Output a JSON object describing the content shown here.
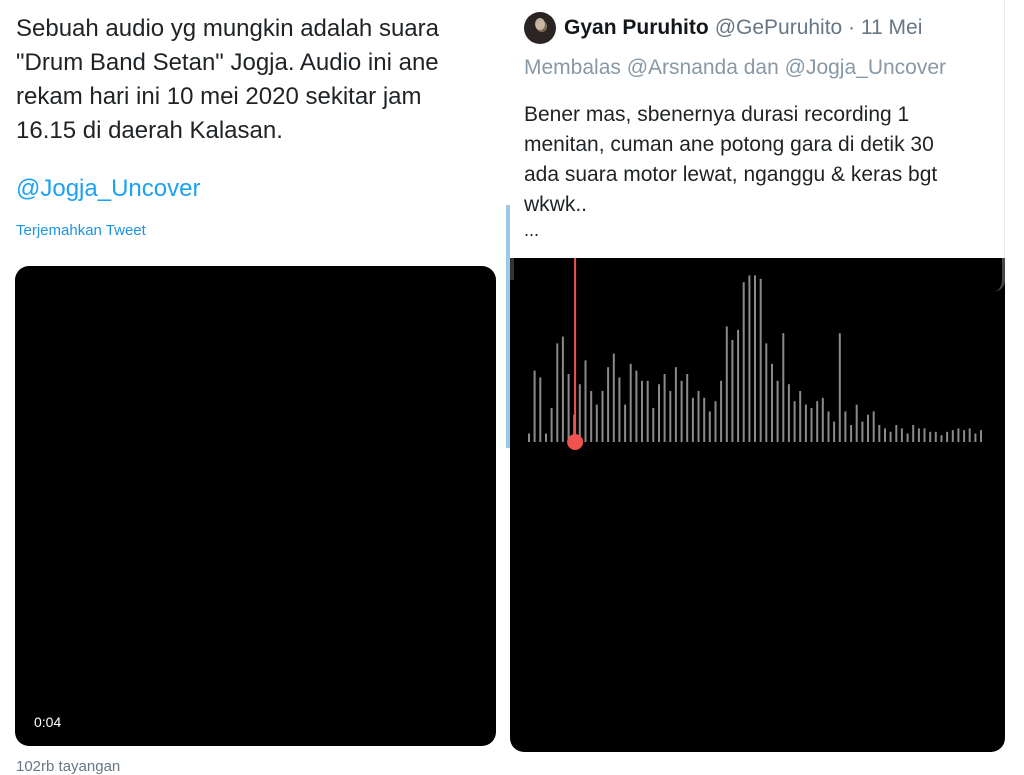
{
  "left_tweet": {
    "text": "Sebuah audio yg mungkin adalah suara\n\"Drum Band Setan\" Jogja. Audio ini ane\nrekam hari ini 10 mei 2020 sekitar jam\n16.15 di daerah Kalasan.",
    "mention": "@Jogja_Uncover",
    "translate_label": "Terjemahkan Tweet",
    "video": {
      "duration": "0:04"
    },
    "views": "102rb tayangan"
  },
  "reply": {
    "display_name": "Gyan Puruhito",
    "handle_date": "@GePuruhito · 11 Mei",
    "replying_to": "Membalas @Arsnanda dan @Jogja_Uncover",
    "body": "Bener mas, sbenernya durasi recording 1\nmenitan, cuman ane potong gara di detik 30\nada suara motor lewat, nganggu & keras bgt\nwkwk..",
    "ellipsis": "...",
    "audio": {
      "playhead_color": "#f0534f",
      "bar_color": "#8a8a8a",
      "playhead_fraction": 0.06,
      "levels": [
        0.05,
        0.42,
        0.38,
        0.05,
        0.2,
        0.58,
        0.62,
        0.4,
        0.16,
        0.34,
        0.48,
        0.3,
        0.22,
        0.3,
        0.44,
        0.52,
        0.38,
        0.22,
        0.46,
        0.42,
        0.36,
        0.36,
        0.2,
        0.34,
        0.4,
        0.3,
        0.44,
        0.36,
        0.4,
        0.26,
        0.3,
        0.26,
        0.18,
        0.24,
        0.36,
        0.68,
        0.6,
        0.66,
        0.94,
        0.98,
        0.98,
        0.96,
        0.58,
        0.46,
        0.36,
        0.64,
        0.34,
        0.24,
        0.3,
        0.22,
        0.2,
        0.24,
        0.26,
        0.18,
        0.12,
        0.64,
        0.18,
        0.1,
        0.22,
        0.12,
        0.16,
        0.18,
        0.1,
        0.08,
        0.06,
        0.1,
        0.08,
        0.05,
        0.1,
        0.08,
        0.08,
        0.06,
        0.06,
        0.04,
        0.06,
        0.07,
        0.08,
        0.07,
        0.08,
        0.05,
        0.07
      ]
    }
  }
}
